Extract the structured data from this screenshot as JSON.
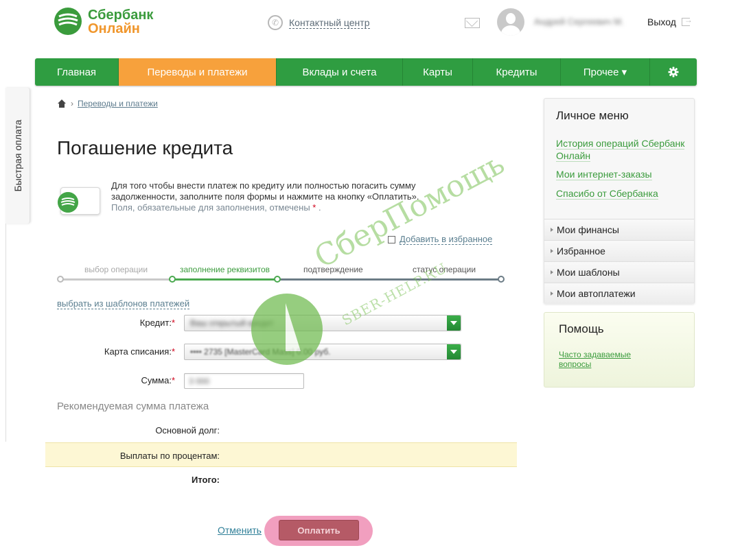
{
  "header": {
    "logo_line1": "Сбербанк",
    "logo_line2": "Онлайн",
    "contact_center": "Контактный центр",
    "user_name": "Андрей Сергеевич М.",
    "logout": "Выход"
  },
  "nav": {
    "items": [
      {
        "label": "Главная",
        "active": false
      },
      {
        "label": "Переводы и платежи",
        "active": true
      },
      {
        "label": "Вклады и счета",
        "active": false
      },
      {
        "label": "Карты",
        "active": false
      },
      {
        "label": "Кредиты",
        "active": false
      },
      {
        "label": "Прочее ▾",
        "active": false
      }
    ],
    "settings_icon": "gear-icon"
  },
  "quick_pay": "Быстрая оплата",
  "breadcrumb": {
    "home_icon": "home-icon",
    "current": "Переводы и платежи"
  },
  "page": {
    "title": "Погашение кредита",
    "info_line1": "Для того чтобы внести платеж по кредиту или полностью погасить сумму",
    "info_line2": "задолженности, заполните поля формы и нажмите на кнопку «Оплатить».",
    "info_required": "Поля, обязательные для заполнения, отмечены",
    "required_star": "*",
    "add_favorite": "Добавить в избранное"
  },
  "steps": [
    {
      "label": "выбор операции",
      "state": "done"
    },
    {
      "label": "заполнение реквизитов",
      "state": "current"
    },
    {
      "label": "подтверждение",
      "state": "pending"
    },
    {
      "label": "статус операции",
      "state": "pending"
    }
  ],
  "form": {
    "templates_link": "выбрать из шаблонов платежей",
    "credit_label": "Кредит:",
    "credit_value": "Ваш открытый кредит",
    "card_label": "Карта списания:",
    "card_value": "•••• 2735 [MasterCard Mass] 0.00 руб.",
    "sum_label": "Сумма:",
    "sum_value": "3 000",
    "star": "*"
  },
  "recommended": {
    "title": "Рекомендуемая сумма платежа",
    "principal": "Основной долг:",
    "interest": "Выплаты по процентам:",
    "total": "Итого:"
  },
  "actions": {
    "cancel": "Отменить",
    "pay": "Оплатить"
  },
  "sidebar": {
    "title": "Личное меню",
    "links": [
      "История операций Сбербанк Онлайн",
      "Мои интернет-заказы",
      "Спасибо от Сбербанка"
    ],
    "menu": [
      "Мои финансы",
      "Избранное",
      "Мои шаблоны",
      "Мои автоплатежи"
    ]
  },
  "help": {
    "title": "Помощь",
    "faq": "Часто задаваемые вопросы"
  },
  "watermark": {
    "line1": "СберПомощь",
    "line2": "SBER-HELP.RU"
  },
  "colors": {
    "green": "#2f9d41",
    "orange": "#f7a13c",
    "link": "#5a7e8f"
  }
}
